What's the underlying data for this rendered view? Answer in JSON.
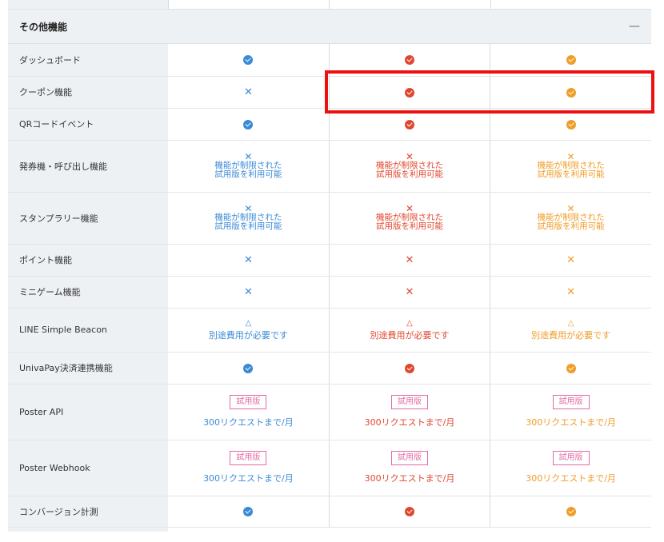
{
  "section": {
    "title": "その他機能",
    "toggle": "—"
  },
  "rows": [
    {
      "label": "ダッシュボード",
      "type": "icon",
      "cells": [
        "check",
        "check",
        "check"
      ]
    },
    {
      "label": "クーポン機能",
      "type": "icon",
      "cells": [
        "cross",
        "check",
        "check"
      ]
    },
    {
      "label": "QRコードイベント",
      "type": "icon",
      "cells": [
        "check",
        "check",
        "check"
      ]
    },
    {
      "label": "発券機・呼び出し機能",
      "type": "limited",
      "symbol": "✕",
      "line1": "機能が制限された",
      "line2": "試用版を利用可能"
    },
    {
      "label": "スタンプラリー機能",
      "type": "limited",
      "symbol": "✕",
      "line1": "機能が制限された",
      "line2": "試用版を利用可能"
    },
    {
      "label": "ポイント機能",
      "type": "icon",
      "cells": [
        "cross",
        "cross",
        "cross"
      ]
    },
    {
      "label": "ミニゲーム機能",
      "type": "icon",
      "cells": [
        "cross",
        "cross",
        "cross"
      ]
    },
    {
      "label": "LINE Simple Beacon",
      "type": "fee",
      "symbol": "△",
      "text": "別途費用が必要です"
    },
    {
      "label": "UnivaPay決済連携機能",
      "type": "icon",
      "cells": [
        "check",
        "check",
        "check"
      ]
    },
    {
      "label": "Poster API",
      "type": "trial",
      "badge": "試用版",
      "text": "300リクエストまで/月"
    },
    {
      "label": "Poster Webhook",
      "type": "trial",
      "badge": "試用版",
      "text": "300リクエストまで/月"
    },
    {
      "label": "コンバージョン計測",
      "type": "icon",
      "cells": [
        "check",
        "check",
        "check"
      ]
    }
  ],
  "plan_colors": [
    "#3a8ad6",
    "#e0472f",
    "#ef9d28"
  ],
  "icons": {
    "check": "check-circle-icon",
    "cross": "cross-icon",
    "fee": "triangle-icon"
  }
}
